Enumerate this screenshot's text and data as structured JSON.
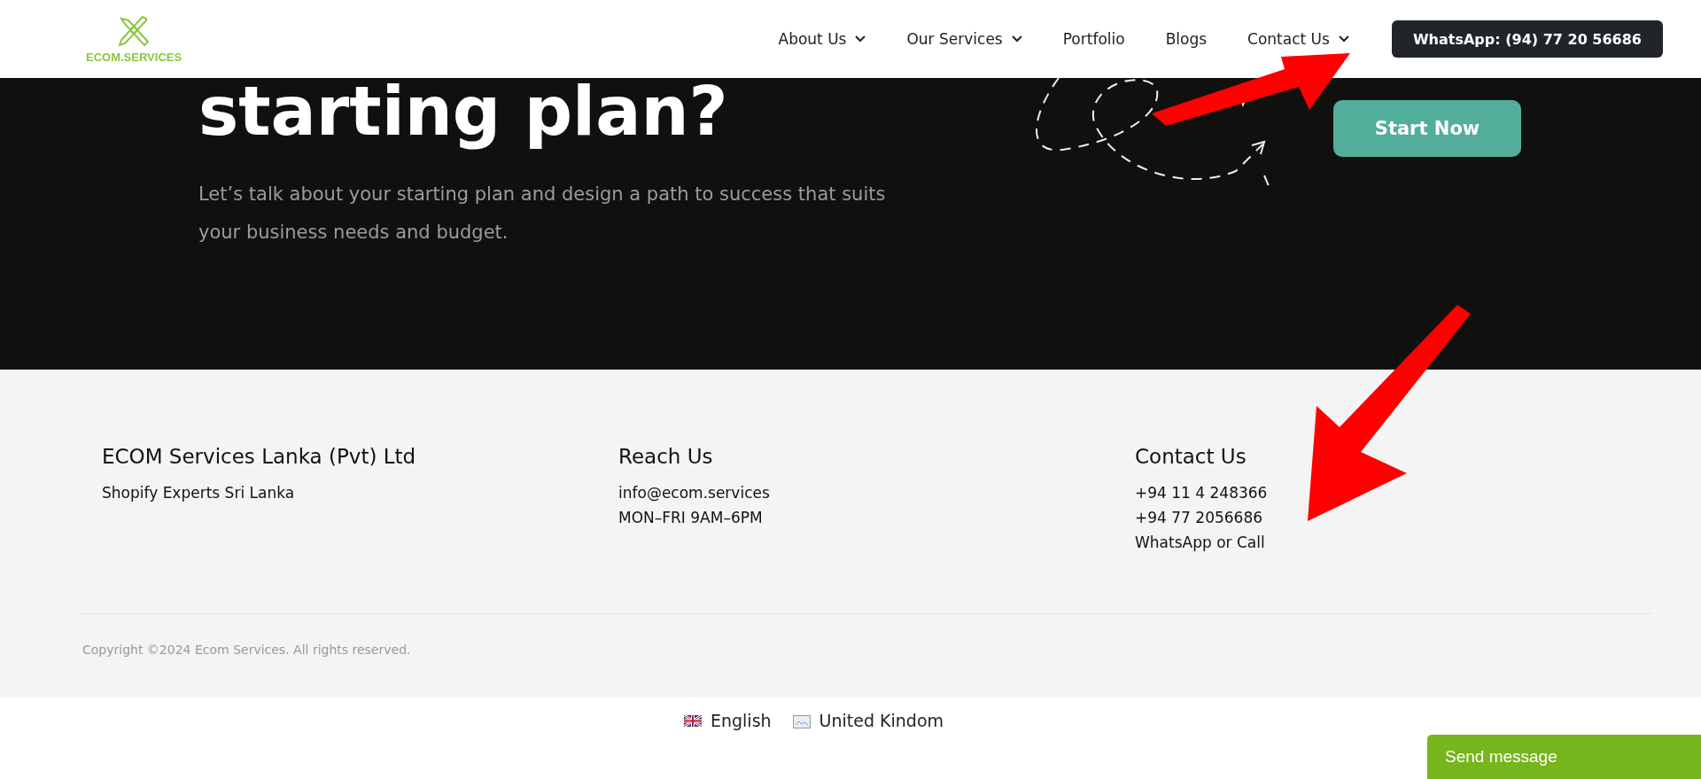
{
  "header": {
    "logo_text": "ECOM.SERVICES",
    "nav": [
      {
        "label": "About Us",
        "has_menu": true
      },
      {
        "label": "Our Services",
        "has_menu": true
      },
      {
        "label": "Portfolio",
        "has_menu": false
      },
      {
        "label": "Blogs",
        "has_menu": false
      },
      {
        "label": "Contact Us",
        "has_menu": true
      }
    ],
    "cta": "WhatsApp: (94) 77 20 56686"
  },
  "hero": {
    "heading": "starting plan?",
    "text": "Let’s talk about your starting plan and design a path to success that suits your business needs and budget.",
    "button": "Start Now"
  },
  "footer": {
    "columns": [
      {
        "title": "ECOM Services Lanka (Pvt) Ltd",
        "lines": [
          "Shopify Experts Sri Lanka"
        ]
      },
      {
        "title": "Reach Us",
        "lines": [
          "info@ecom.services",
          "MON–FRI 9AM–6PM"
        ]
      },
      {
        "title": "Contact Us",
        "lines": [
          "+94 11 4 248366",
          "+94 77 2056686",
          "WhatsApp or Call"
        ]
      }
    ],
    "copyright": "Copyright ©2024 Ecom Services. All rights reserved."
  },
  "languages": [
    {
      "label": "English",
      "kind": "flag"
    },
    {
      "label": "United Kindom",
      "kind": "broken-image"
    }
  ],
  "chat_button": "Send message"
}
